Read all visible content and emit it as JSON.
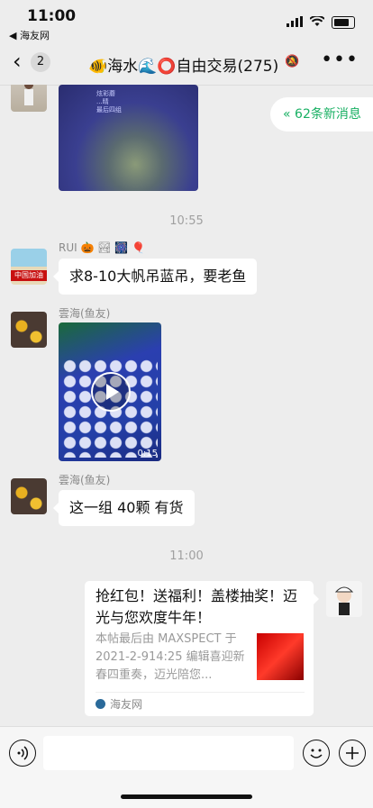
{
  "status": {
    "time": "11:00",
    "back_app": "◀ 海友网"
  },
  "nav": {
    "back_icon": "‹",
    "unread_count": "2",
    "title": "🐠海水🌊⭕自由交易(275)",
    "mute_icon": "🔕",
    "more_icon": "•••"
  },
  "new_messages": {
    "label": "62条新消息",
    "icon": "double-chevron-up-icon"
  },
  "image_caption": "炫彩蘑\n...晴\n最后四组",
  "timestamps": [
    "10:55",
    "11:00"
  ],
  "messages": [
    {
      "sender": "RUI 🎃 🏞 🎆 🎈",
      "text": "求8-10大帆吊蓝吊，要老鱼",
      "avatar_label": "中国加油"
    },
    {
      "sender": "雲海(鱼友)",
      "video_duration": "0:15"
    },
    {
      "sender": "雲海(鱼友)",
      "text": "这一组 40颗  有货"
    }
  ],
  "link_card": {
    "title": "抢红包！送福利！盖楼抽奖！迈光与您欢度牛年！",
    "description": "本帖最后由 MAXSPECT 于 2021-2-914:25 编辑喜迎新春四重奏，迈光陪您...",
    "source": "海友网"
  },
  "input": {
    "voice_icon": "voice-icon",
    "emoji_icon": "emoji-icon",
    "plus_icon": "plus-icon"
  }
}
